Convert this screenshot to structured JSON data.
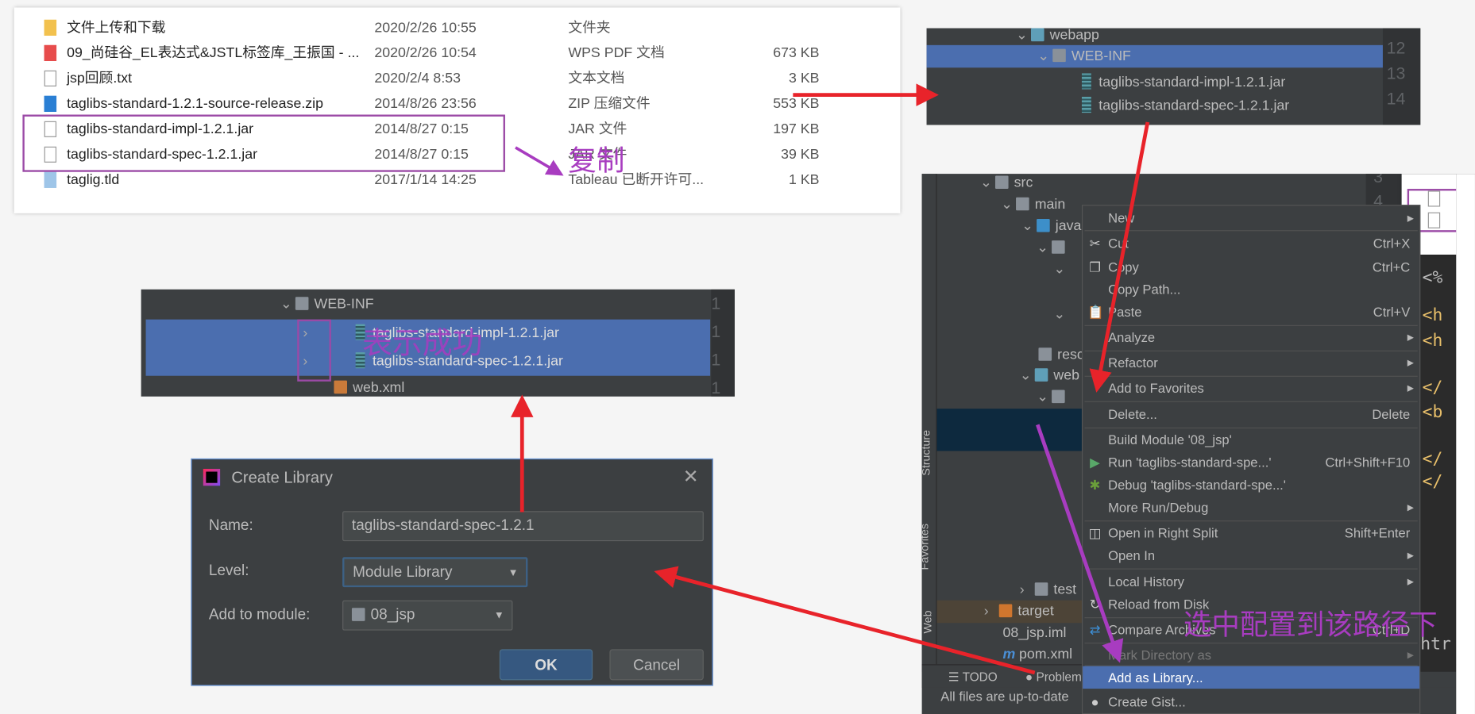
{
  "file_explorer": {
    "rows": [
      {
        "name": "文件上传和下载",
        "date": "2020/2/26 10:55",
        "type": "文件夹",
        "size": "",
        "icon": "folder-icon"
      },
      {
        "name": "09_尚硅谷_EL表达式&JSTL标签库_王振国 - ...",
        "date": "2020/2/26 10:54",
        "type": "WPS PDF 文档",
        "size": "673 KB",
        "icon": "pdf-icon"
      },
      {
        "name": "jsp回顾.txt",
        "date": "2020/2/4 8:53",
        "type": "文本文档",
        "size": "3 KB",
        "icon": "text-file-icon"
      },
      {
        "name": "taglibs-standard-1.2.1-source-release.zip",
        "date": "2014/8/26 23:56",
        "type": "ZIP 压缩文件",
        "size": "553 KB",
        "icon": "zip-icon"
      },
      {
        "name": "taglibs-standard-impl-1.2.1.jar",
        "date": "2014/8/27 0:15",
        "type": "JAR 文件",
        "size": "197 KB",
        "icon": "file-icon"
      },
      {
        "name": "taglibs-standard-spec-1.2.1.jar",
        "date": "2014/8/27 0:15",
        "type": "JAR 文件",
        "size": "39 KB",
        "icon": "file-icon"
      },
      {
        "name": "taglig.tld",
        "date": "2017/1/14 14:25",
        "type": "Tableau 已断开许可...",
        "size": "1 KB",
        "icon": "tld-icon"
      }
    ]
  },
  "annotations": {
    "copy": "复制",
    "success": "表示成功",
    "select_path": "选中配置到该路径下"
  },
  "top_tree": {
    "rows": [
      "webapp",
      "WEB-INF",
      "taglibs-standard-impl-1.2.1.jar",
      "taglibs-standard-spec-1.2.1.jar"
    ],
    "line_numbers": [
      "12",
      "13",
      "14"
    ]
  },
  "mid_tree": {
    "rows": [
      "WEB-INF",
      "taglibs-standard-impl-1.2.1.jar",
      "taglibs-standard-spec-1.2.1.jar",
      "web.xml"
    ],
    "line_numbers": [
      "1",
      "1",
      "1",
      "1"
    ]
  },
  "dialog": {
    "title": "Create Library",
    "name_label": "Name:",
    "name_value": "taglibs-standard-spec-1.2.1",
    "level_label": "Level:",
    "level_value": "Module Library",
    "module_label": "Add to module:",
    "module_value": "08_jsp",
    "ok": "OK",
    "cancel": "Cancel"
  },
  "ide": {
    "tree": [
      "src",
      "main",
      "java",
      "resc",
      "web",
      "test",
      "target",
      "08_jsp.iml",
      "pom.xml"
    ],
    "side_tabs": [
      "Structure",
      "Favorites",
      "Web"
    ],
    "bottom_tabs": [
      "TODO",
      "Problem"
    ],
    "status": "All files are up-to-date",
    "line_numbers": [
      "3",
      "4"
    ],
    "editor_snips": [
      "<%",
      "<h",
      "<h",
      "</",
      "<b",
      "</",
      "</",
      "htr"
    ],
    "menu": [
      {
        "label": "New",
        "submenu": true
      },
      {
        "label": "Cut",
        "shortcut": "Ctrl+X",
        "icon": "scissors-icon"
      },
      {
        "label": "Copy",
        "shortcut": "Ctrl+C",
        "icon": "copy-icon"
      },
      {
        "label": "Copy Path..."
      },
      {
        "label": "Paste",
        "shortcut": "Ctrl+V",
        "icon": "paste-icon"
      },
      {
        "label": "Analyze",
        "submenu": true
      },
      {
        "label": "Refactor",
        "submenu": true
      },
      {
        "label": "Add to Favorites",
        "submenu": true
      },
      {
        "label": "Delete...",
        "shortcut": "Delete"
      },
      {
        "label": "Build Module '08_jsp'"
      },
      {
        "label": "Run 'taglibs-standard-spe...'",
        "shortcut": "Ctrl+Shift+F10",
        "icon": "run-icon"
      },
      {
        "label": "Debug 'taglibs-standard-spe...'",
        "icon": "debug-icon"
      },
      {
        "label": "More Run/Debug",
        "submenu": true
      },
      {
        "label": "Open in Right Split",
        "shortcut": "Shift+Enter",
        "icon": "split-icon"
      },
      {
        "label": "Open In",
        "submenu": true
      },
      {
        "label": "Local History",
        "submenu": true
      },
      {
        "label": "Reload from Disk",
        "icon": "reload-icon"
      },
      {
        "label": "Compare Archives",
        "shortcut": "Ctrl+D",
        "icon": "compare-icon"
      },
      {
        "label": "Mark Directory as",
        "submenu": true
      },
      {
        "label": "Add as Library...",
        "highlighted": true
      },
      {
        "label": "Create Gist...",
        "icon": "github-icon"
      }
    ]
  },
  "colors": {
    "selection": "#4b6eaf",
    "arrow_red": "#e8232a",
    "annotation_purple": "#a83cc0",
    "ide_bg": "#3c3f41"
  }
}
